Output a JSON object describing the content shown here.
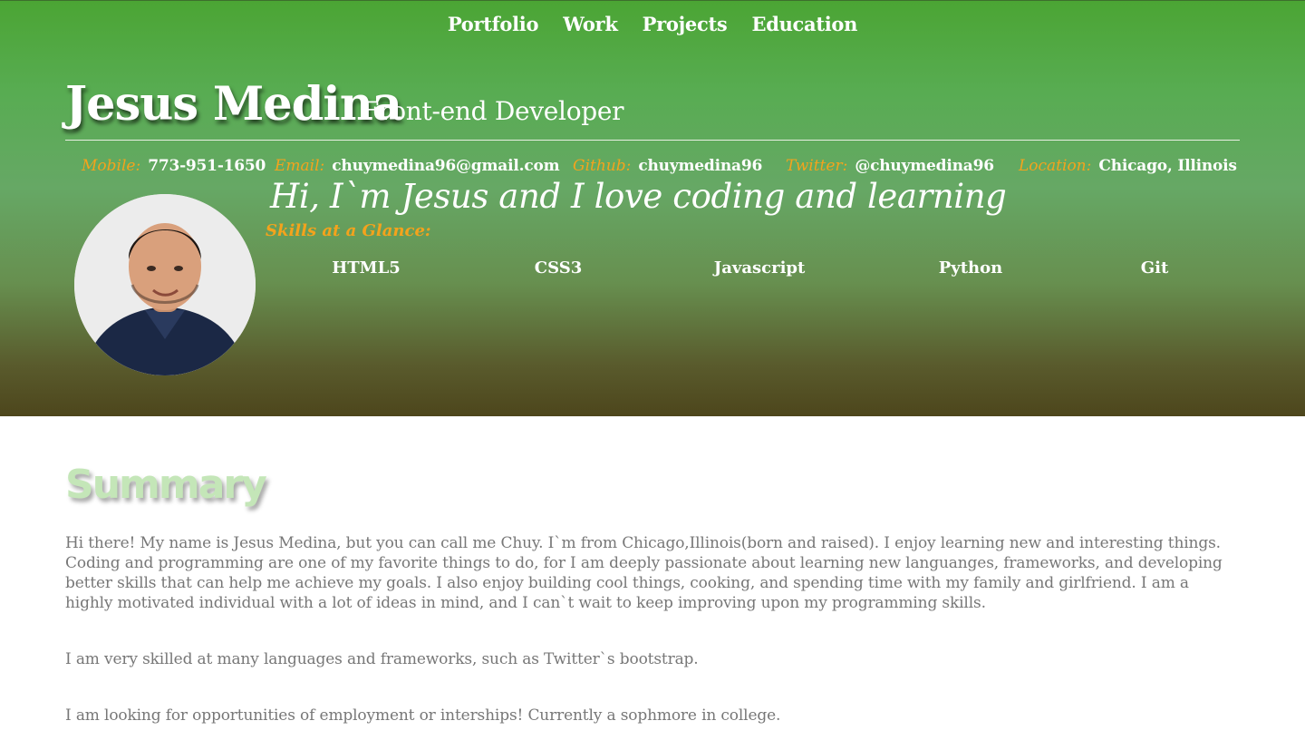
{
  "nav": {
    "items": [
      "Portfolio",
      "Work",
      "Projects",
      "Education"
    ]
  },
  "header": {
    "name": "Jesus Medina",
    "role": "Front-end Developer"
  },
  "contact": {
    "mobile": {
      "label": "Mobile:",
      "value": "773-951-1650"
    },
    "email": {
      "label": "Email:",
      "value": "chuymedina96@gmail.com"
    },
    "github": {
      "label": "Github:",
      "value": "chuymedina96"
    },
    "twitter": {
      "label": "Twitter:",
      "value": "@chuymedina96"
    },
    "location": {
      "label": "Location:",
      "value": "Chicago, Illinois"
    }
  },
  "tagline": "Hi, I`m Jesus and I love coding and learning",
  "skills": {
    "title": "Skills at a Glance:",
    "items": [
      "HTML5",
      "CSS3",
      "Javascript",
      "Python",
      "Git"
    ]
  },
  "summary": {
    "heading": "Summary",
    "paragraphs": [
      "Hi there! My name is Jesus Medina, but you can call me Chuy. I`m from Chicago,Illinois(born and raised). I enjoy learning new and interesting things. Coding and programming are one of my favorite things to do, for I am deeply passionate about learning new languanges, frameworks, and developing better skills that can help me achieve my goals. I also enjoy building cool things, cooking, and spending time with my family and girlfriend. I am a highly motivated individual with a lot of ideas in mind, and I can`t wait to keep improving upon my programming skills.",
      "I am very skilled at many languages and frameworks, such as Twitter`s bootstrap.",
      "I am looking for opportunities of employment or interships! Currently a sophmore in college."
    ]
  },
  "colors": {
    "accent": "#f4a31c",
    "header_top": "#4ba534",
    "header_bottom": "#4d461c",
    "summary_heading": "#c4e6b8"
  }
}
